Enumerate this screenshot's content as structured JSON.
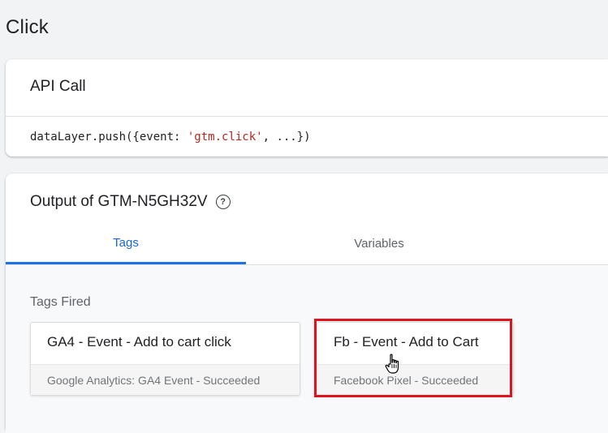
{
  "page": {
    "title": "Click"
  },
  "api_call": {
    "title": "API Call",
    "code_prefix": "dataLayer.push({event: ",
    "code_string": "'gtm.click'",
    "code_suffix": ", ...})"
  },
  "output": {
    "title": "Output of GTM-N5GH32V",
    "help_icon": "help-circle-icon",
    "tabs": [
      {
        "label": "Tags",
        "active": true
      },
      {
        "label": "Variables",
        "active": false
      }
    ],
    "section_label": "Tags Fired",
    "tags": [
      {
        "name": "GA4 - Event - Add to cart click",
        "status": "Google Analytics: GA4 Event - Succeeded"
      },
      {
        "name": "Fb - Event - Add to Cart",
        "status": "Facebook Pixel - Succeeded"
      }
    ]
  },
  "colors": {
    "active_tab": "#1a73e8",
    "highlight": "#e0141c",
    "code_string": "#b3261e"
  }
}
